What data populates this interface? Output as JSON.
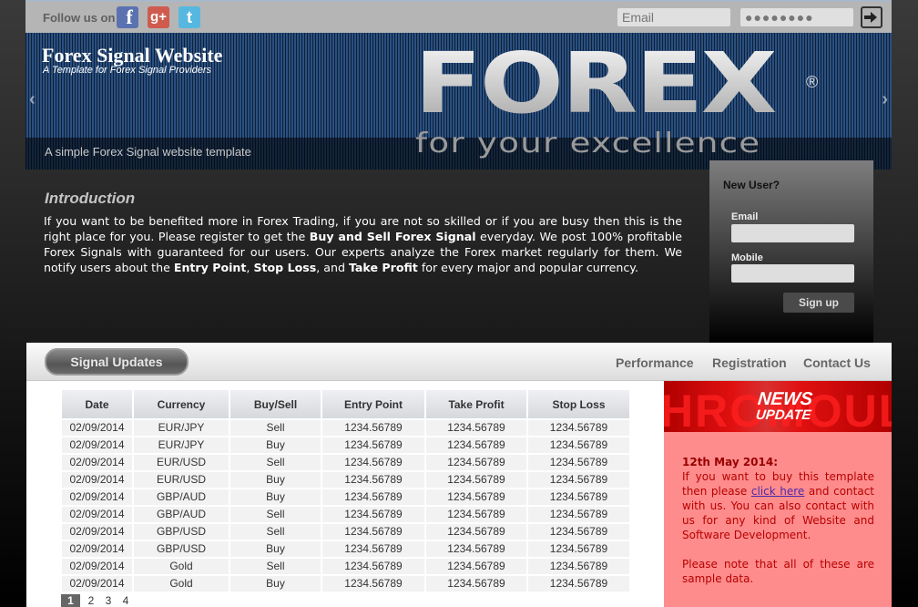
{
  "topbar": {
    "follow_label": "Follow us on",
    "social": [
      {
        "name": "facebook",
        "glyph": "f"
      },
      {
        "name": "google-plus",
        "glyph": "g+"
      },
      {
        "name": "twitter",
        "glyph": "t"
      }
    ],
    "email_placeholder": "Email",
    "password_value": "●●●●●●●●"
  },
  "banner": {
    "title": "Forex Signal Website",
    "subtitle": "A Template for Forex Signal Providers",
    "logo_text": "FOREX",
    "logo_registered": "®",
    "logo_tagline": "for your excellence",
    "caption": "A simple Forex Signal website template",
    "prev_arrow": "‹",
    "next_arrow": "›"
  },
  "intro": {
    "title": "Introduction",
    "p1": "If you want to be benefited more in Forex Trading, if you are not so skilled or if you are busy then this is the right place for you. Please register to get the ",
    "b1": "Buy and Sell Forex Signal",
    "p2": " everyday. We post 100% profitable Forex Signals with guaranteed for our users. Our experts analyze the Forex market regularly for them. We notify users about the ",
    "b2": "Entry Point",
    "p3": ", ",
    "b3": "Stop Loss",
    "p4": ", and ",
    "b4": "Take Profit",
    "p5": " for every major and popular currency."
  },
  "signup": {
    "title": "New User?",
    "email_label": "Email",
    "mobile_label": "Mobile",
    "button": "Sign up"
  },
  "nav": {
    "active": "Signal Updates",
    "links": [
      "Performance",
      "Registration",
      "Contact Us"
    ]
  },
  "signals": {
    "headers": [
      "Date",
      "Currency",
      "Buy/Sell",
      "Entry Point",
      "Take Profit",
      "Stop Loss"
    ],
    "rows": [
      [
        "02/09/2014",
        "EUR/JPY",
        "Sell",
        "1234.56789",
        "1234.56789",
        "1234.56789"
      ],
      [
        "02/09/2014",
        "EUR/JPY",
        "Buy",
        "1234.56789",
        "1234.56789",
        "1234.56789"
      ],
      [
        "02/09/2014",
        "EUR/USD",
        "Sell",
        "1234.56789",
        "1234.56789",
        "1234.56789"
      ],
      [
        "02/09/2014",
        "EUR/USD",
        "Buy",
        "1234.56789",
        "1234.56789",
        "1234.56789"
      ],
      [
        "02/09/2014",
        "GBP/AUD",
        "Buy",
        "1234.56789",
        "1234.56789",
        "1234.56789"
      ],
      [
        "02/09/2014",
        "GBP/AUD",
        "Sell",
        "1234.56789",
        "1234.56789",
        "1234.56789"
      ],
      [
        "02/09/2014",
        "GBP/USD",
        "Sell",
        "1234.56789",
        "1234.56789",
        "1234.56789"
      ],
      [
        "02/09/2014",
        "GBP/USD",
        "Buy",
        "1234.56789",
        "1234.56789",
        "1234.56789"
      ],
      [
        "02/09/2014",
        "Gold",
        "Sell",
        "1234.56789",
        "1234.56789",
        "1234.56789"
      ],
      [
        "02/09/2014",
        "Gold",
        "Buy",
        "1234.56789",
        "1234.56789",
        "1234.56789"
      ]
    ],
    "pages": [
      "1",
      "2",
      "3",
      "4"
    ],
    "current_page": "1"
  },
  "news": {
    "badge_line1": "NEWS",
    "badge_line2": "UPDATE",
    "bg_text": "HROMOULT",
    "date": "12th May 2014:",
    "t1": "If you want to buy this template then please ",
    "link": "click here",
    "t2": " and contact with us. You can also contact with us for any kind of Website and Software Development.",
    "t3": "Please note that all of these are sample data."
  },
  "colors": {
    "banner_blue": "#1a365a",
    "news_bg": "#ff8c8c",
    "news_text": "#b80000",
    "topbar": "#b5b5b5"
  }
}
